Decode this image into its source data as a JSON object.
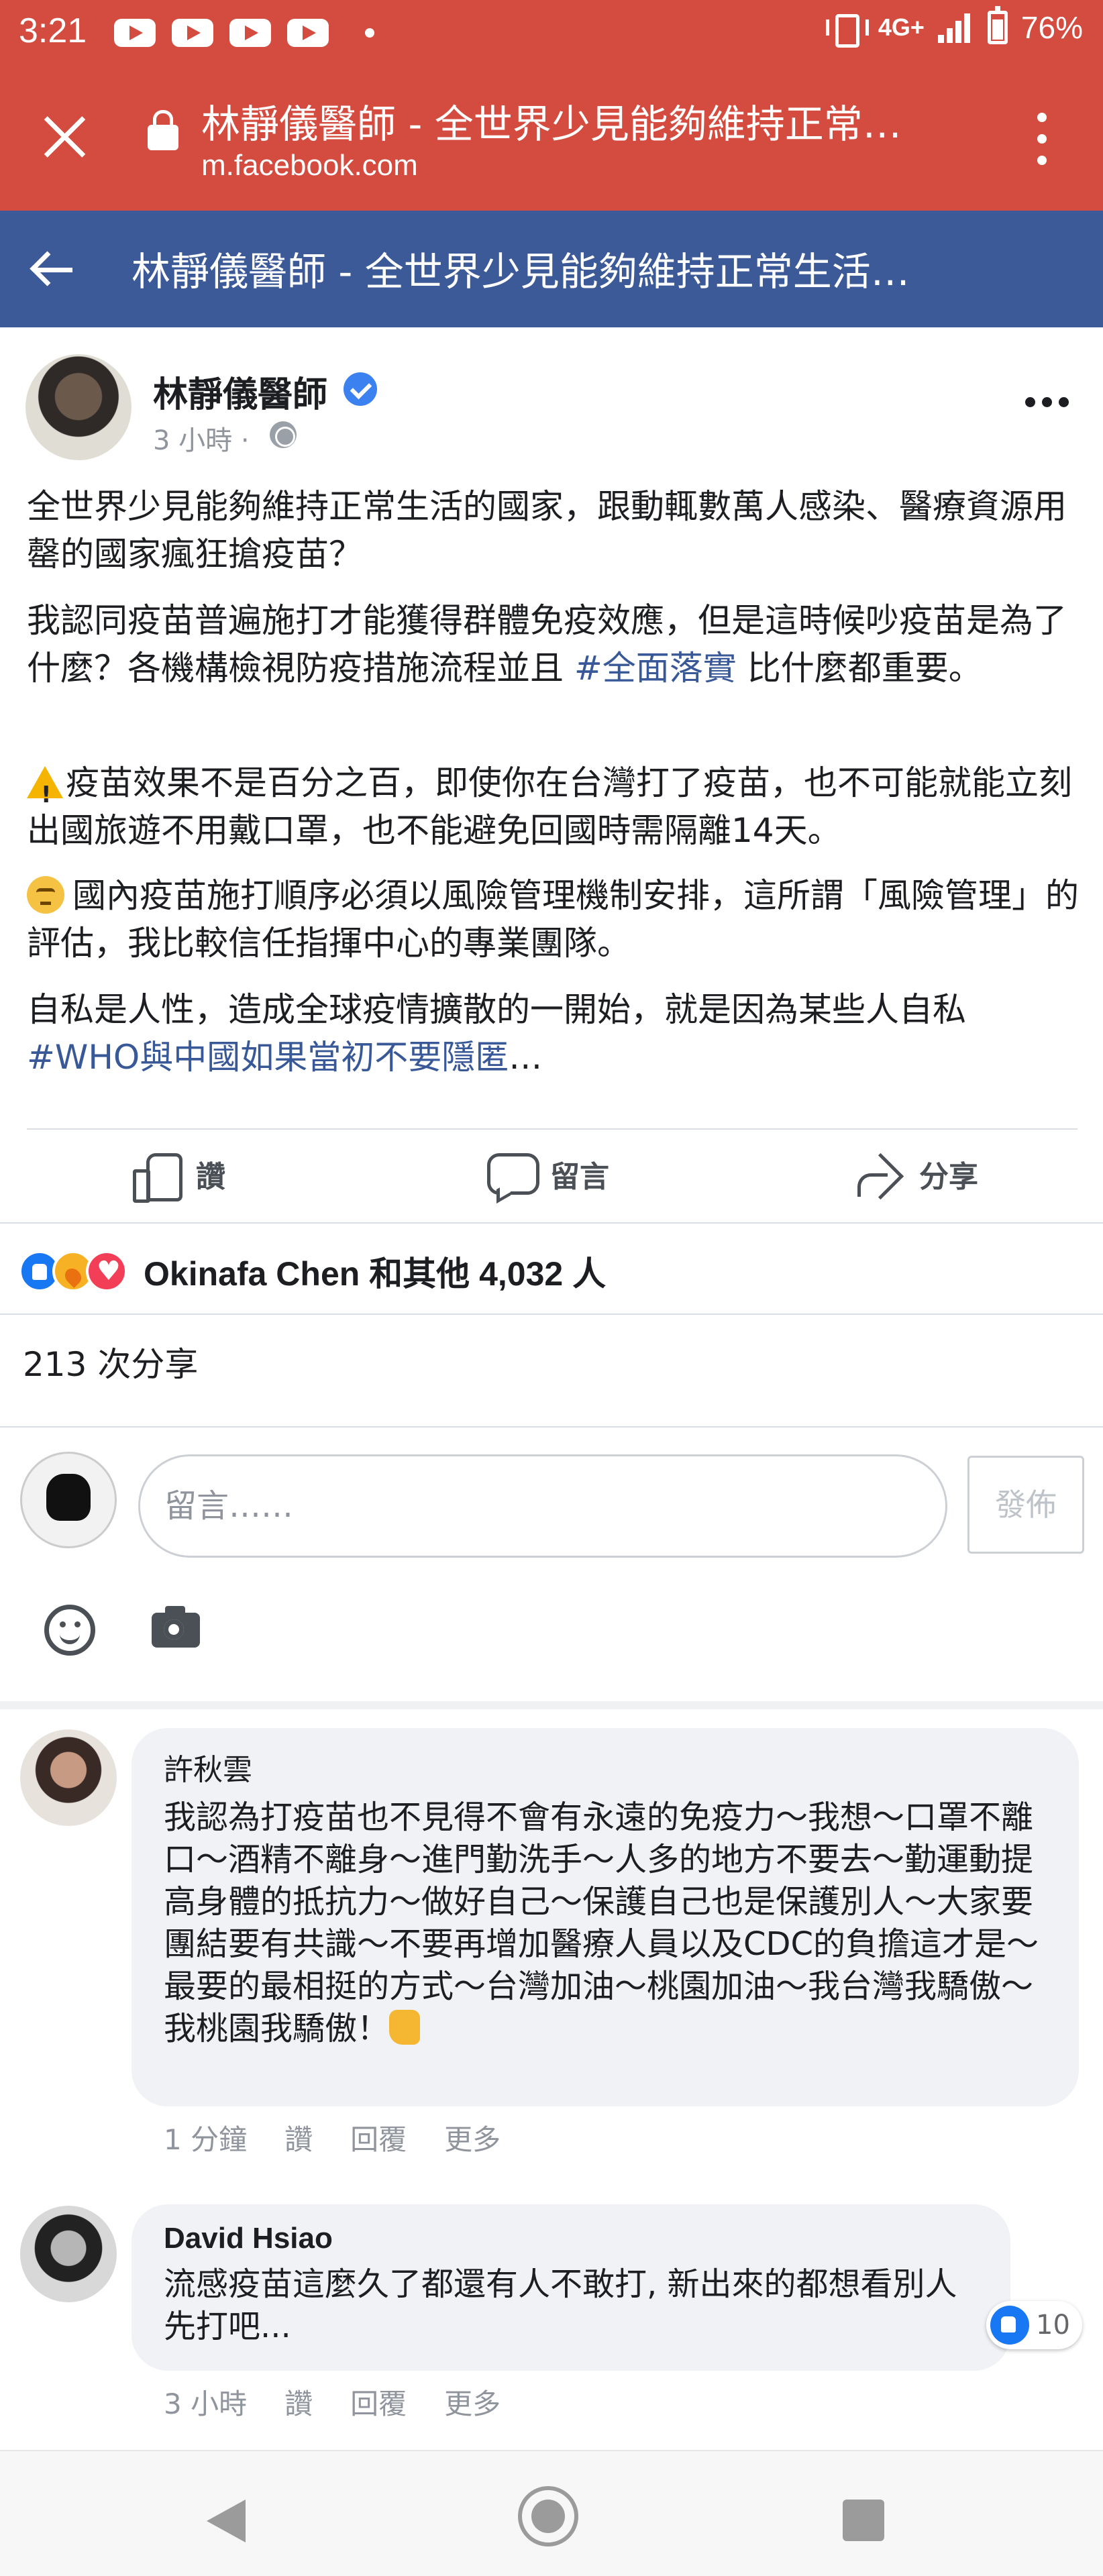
{
  "status_bar": {
    "time": "3:21",
    "network": "4G+",
    "battery": "76%"
  },
  "browser": {
    "title": "林靜儀醫師 - 全世界少見能夠維持正常…",
    "url": "m.facebook.com"
  },
  "fb_nav": {
    "title": "林靜儀醫師 - 全世界少見能夠維持正常生活…"
  },
  "post": {
    "author": "林靜儀醫師",
    "time": "3 小時 ·",
    "paragraphs": {
      "p1": "全世界少見能夠維持正常生活的國家，跟動輒數萬人感染、醫療資源用罄的國家瘋狂搶疫苗？",
      "p2_a": "我認同疫苗普遍施打才能獲得群體免疫效應，但是這時候吵疫苗是為了什麼？各機構檢視防疫措施流程並且",
      "p2_tag": "#全面落實",
      "p2_b": "比什麼都重要。",
      "p3": "疫苗效果不是百分之百，即使你在台灣打了疫苗，也不可能就能立刻出國旅遊不用戴口罩，也不能避免回國時需隔離14天。",
      "p4": "國內疫苗施打順序必須以風險管理機制安排，這所謂「風險管理」的評估，我比較信任指揮中心的專業團隊。",
      "p5_a": "自私是人性，造成全球疫情擴散的一開始，就是因為某些人自私",
      "p5_tag": "#WHO與中國如果當初不要隱匿",
      "p5_more": "…"
    }
  },
  "actions": {
    "like": "讚",
    "comment": "留言",
    "share": "分享"
  },
  "reactions": {
    "text": "Okinafa Chen 和其他 4,032 人"
  },
  "shares": {
    "text": "213 次分享"
  },
  "composer": {
    "placeholder": "留言……",
    "post_label": "發佈"
  },
  "comments": [
    {
      "name": "許秋雲",
      "text": "我認為打疫苗也不見得不會有永遠的免疫力～我想～口罩不離口～酒精不離身～進門勤洗手～人多的地方不要去～勤運動提高身體的抵抗力～做好自己～保護自己也是保護別人～大家要團結要有共識～不要再增加醫療人員以及CDC的負擔這才是～最要的最相挺的方式～台灣加油～桃園加油～我台灣我驕傲～我桃園我驕傲！",
      "time": "1 分鐘",
      "like": "讚",
      "reply": "回覆",
      "more": "更多"
    },
    {
      "name": "David Hsiao",
      "text": "流感疫苗這麼久了都還有人不敢打, 新出來的都想看別人先打吧...",
      "time": "3 小時",
      "like": "讚",
      "reply": "回覆",
      "more": "更多",
      "reaction_count": "10"
    }
  ],
  "colors": {
    "status_bar": "#d44b3f",
    "fb_blue": "#3d5a98",
    "hashtag": "#385898",
    "comment_bubble": "#f0f2f5"
  },
  "icons": [
    "close-icon",
    "lock-icon",
    "more-vert-icon",
    "back-arrow-icon",
    "verified-icon",
    "globe-icon",
    "more-horiz-icon",
    "like-icon",
    "comment-icon",
    "share-icon",
    "emoji-icon",
    "camera-icon"
  ]
}
